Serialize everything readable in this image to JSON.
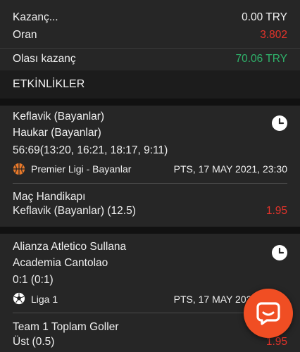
{
  "summary": {
    "stake_label": "Kazanç...",
    "stake_value": "0.00 TRY",
    "odds_label": "Oran",
    "odds_value": "3.802",
    "potential_label": "Olası kazanç",
    "potential_value": "70.06 TRY"
  },
  "section_title": "ETKİNLİKLER",
  "events": [
    {
      "home": "Keflavik (Bayanlar)",
      "away": "Haukar (Bayanlar)",
      "score": "56:69(13:20, 16:21, 18:17, 9:11)",
      "league": "Premier Ligi - Bayanlar",
      "datetime": "PTS, 17 MAY 2021, 23:30",
      "sport_icon": "basketball-icon",
      "market": "Maç Handikapı",
      "selection": "Keflavik (Bayanlar) (12.5)",
      "odd": "1.95"
    },
    {
      "home": "Alianza Atletico Sullana",
      "away": "Academia Cantolao",
      "score": "0:1 (0:1)",
      "league": "Liga 1",
      "datetime": "PTS, 17 MAY 2021, 23:30",
      "sport_icon": "soccer-ball-icon",
      "market": "Team 1 Toplam Goller",
      "selection": "Üst (0.5)",
      "odd": "1.95"
    }
  ],
  "colors": {
    "odds_red": "#e5332a",
    "potential_green": "#2fb36b",
    "chat_orange": "#f04e23"
  }
}
